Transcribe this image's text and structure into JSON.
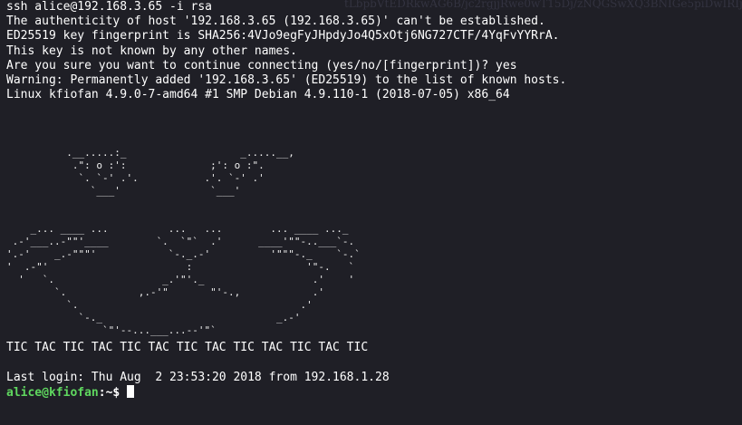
{
  "terminal": {
    "ghost_text": "tLbpbVtEDRkwAG6B/jc2rgjjRwe0wT15Dj/zNQGSwXQ3BNIGe5piDwIRIjt",
    "header_lines": [
      "ssh alice@192.168.3.65 -i rsa",
      "The authenticity of host '192.168.3.65 (192.168.3.65)' can't be established.",
      "ED25519 key fingerprint is SHA256:4VJo9egFyJHpdyJo4Q5xOtj6NG727CTF/4YqFvYYRrA.",
      "This key is not known by any other names.",
      "Are you sure you want to continue connecting (yes/no/[fingerprint])? yes",
      "Warning: Permanently added '192.168.3.65' (ED25519) to the list of known hosts.",
      "Linux kfiofan 4.9.0-7-amd64 #1 SMP Debian 4.9.110-1 (2018-07-05) x86_64"
    ],
    "ascii_art": "          .__.....:_                   _.....__,\n           .\": o :':              ;': o :\".\n            `. `-' .'.           .'. `-' .'\n              `___'               `___'\n\n\n    _... ____ ...          ...   ...        ... ____ ..._\n .-'___..-\"\"'____        `.  `\"`  .'      ____'\"\"-..___`-.\n'.-'    _.-\"\"\"'            `-._.-'          '\"\"\"-._    `-.`\n'  .-\"'                       :                   '\"-.   `\n  '   `.                  _.'\"'._                  .'    '\n        `.            ,.-'\"       \"'-.,            .'\n          `.                                     .'\n            `-._                             _.-'\n                `\"'--...___...--'\"`",
    "tictac": "TIC TAC TIC TAC TIC TAC TIC TAC TIC TAC TIC TAC TIC",
    "last_login": "Last login: Thu Aug  2 23:53:20 2018 from 192.168.1.28",
    "prompt": {
      "user_host": "alice@kfiofan",
      "path": ":~$ "
    }
  },
  "colors": {
    "background": "#1f1f26",
    "text": "#ffffff",
    "prompt_user": "#5fd75f"
  }
}
